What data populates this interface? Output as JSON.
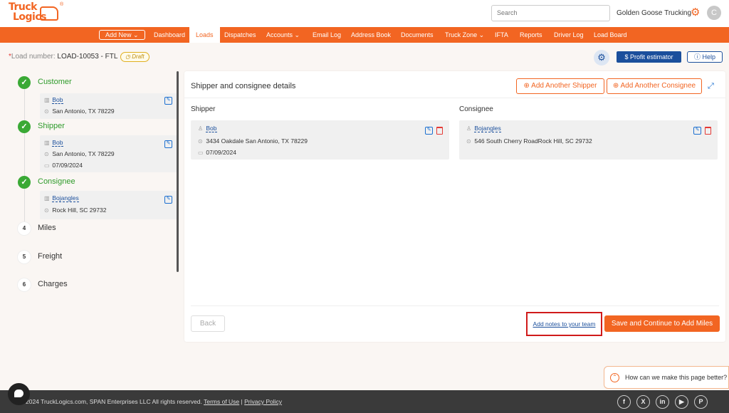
{
  "header": {
    "logo_line1": "Truck",
    "logo_line2": "Logics",
    "logo_reg": "®",
    "search_placeholder": "Search",
    "company_name": "Golden Goose Trucking",
    "avatar_initial": "C"
  },
  "nav": {
    "add_new": "Add New ⌄",
    "items": [
      "Dashboard",
      "Loads",
      "Dispatches",
      "Accounts ⌄",
      "Email Log",
      "Address Book",
      "Documents",
      "Truck Zone ⌄",
      "IFTA",
      "Reports",
      "Driver Log",
      "Load Board"
    ],
    "active": "Loads"
  },
  "load": {
    "asterisk": "*",
    "label": "Load number:",
    "number": "LOAD-10053 - FTL",
    "status": "Draft",
    "profit_estimator": "$ Profit estimator",
    "help": "Help"
  },
  "steps": {
    "customer": {
      "title": "Customer",
      "name": "Bob",
      "address": "San Antonio, TX 78229"
    },
    "shipper": {
      "title": "Shipper",
      "name": "Bob",
      "address": "San Antonio, TX 78229",
      "date": "07/09/2024"
    },
    "consignee": {
      "title": "Consignee",
      "name": "Bojangles",
      "address": "Rock Hill, SC 29732"
    },
    "miles": {
      "num": "4",
      "title": "Miles"
    },
    "freight": {
      "num": "5",
      "title": "Freight"
    },
    "charges": {
      "num": "6",
      "title": "Charges"
    }
  },
  "details": {
    "title": "Shipper and consignee details",
    "add_shipper": "Add Another Shipper",
    "add_consignee": "Add Another Consignee",
    "shipper_label": "Shipper",
    "consignee_label": "Consignee",
    "shipper": {
      "name": "Bob",
      "address": "3434 Oakdale  San Antonio,  TX  78229",
      "date": "07/09/2024"
    },
    "consignee": {
      "name": "Bojangles",
      "address": "546 South Cherry RoadRock Hill, SC 29732"
    },
    "back": "Back",
    "notes_link": "Add notes to your team",
    "save_continue": "Save and Continue to Add Miles"
  },
  "feedback": {
    "text": "How can we make this page better?"
  },
  "footer": {
    "copyright": "2024 TruckLogics.com, SPAN Enterprises LLC All rights reserved.",
    "terms": "Terms of Use",
    "separator": "|",
    "privacy": "Privacy Policy"
  },
  "colors": {
    "brand_orange": "#f26522",
    "brand_blue": "#1b4f9c",
    "success_green": "#3aa935",
    "danger_red": "#e53935"
  }
}
